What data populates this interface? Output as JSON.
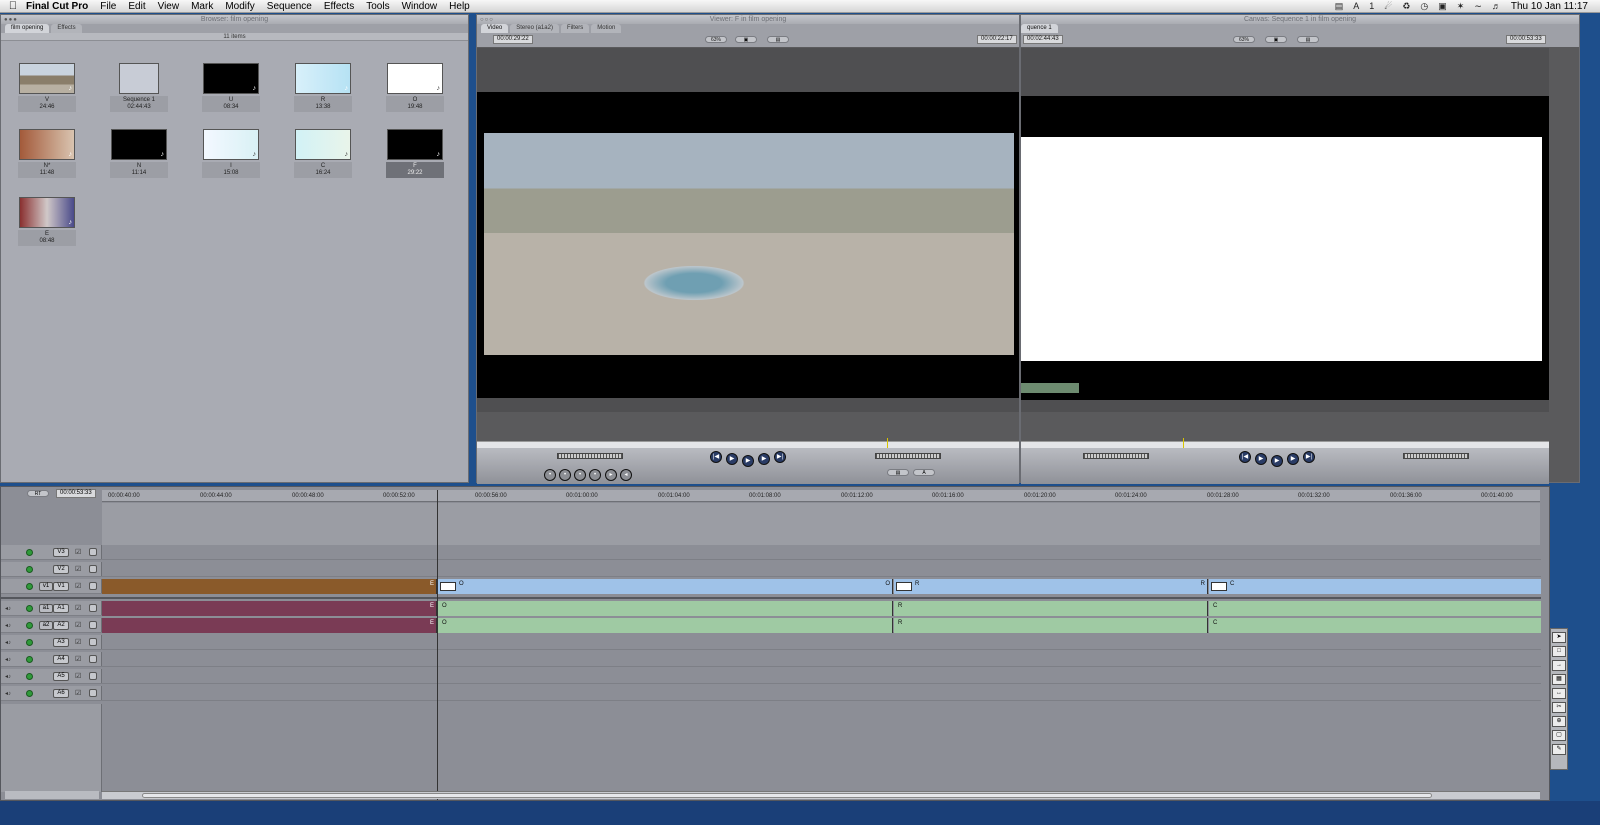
{
  "menubar": {
    "app": "Final Cut Pro",
    "items": [
      "File",
      "Edit",
      "View",
      "Mark",
      "Modify",
      "Sequence",
      "Effects",
      "Tools",
      "Window",
      "Help"
    ],
    "clock": "Thu 10 Jan  11:17",
    "status": "1"
  },
  "browser": {
    "title": "Browser: film opening",
    "tabs": [
      "film opening",
      "Effects"
    ],
    "count": "11 items",
    "clips": [
      {
        "name": "V",
        "dur": "24:46"
      },
      {
        "name": "Sequence 1",
        "dur": "02:44:43"
      },
      {
        "name": "U",
        "dur": "08:34"
      },
      {
        "name": "R",
        "dur": "13:38"
      },
      {
        "name": "O",
        "dur": "19:48"
      },
      {
        "name": "N*",
        "dur": "11:48"
      },
      {
        "name": "N",
        "dur": "11:14"
      },
      {
        "name": "I",
        "dur": "15:08"
      },
      {
        "name": "C",
        "dur": "16:24"
      },
      {
        "name": "F",
        "dur": "29:22"
      },
      {
        "name": "E",
        "dur": "08:48"
      }
    ]
  },
  "viewer": {
    "title": "Viewer: F in film opening",
    "tabs": [
      "Video",
      "Stereo (a1a2)",
      "Filters",
      "Motion"
    ],
    "tc_left": "00:00:29:22",
    "tc_right": "00:00:22:17",
    "zoom": "63%"
  },
  "canvas": {
    "title": "Canvas: Sequence 1 in film opening",
    "tab": "quence 1",
    "tc_left": "00:02:44:43",
    "tc_right": "00:00:53:33",
    "zoom": "63%"
  },
  "timeline": {
    "rt": "RT",
    "tc": "00:00:53:33",
    "ruler": [
      "00:00:40:00",
      "00:00:44:00",
      "00:00:48:00",
      "00:00:52:00",
      "00:00:56:00",
      "00:01:00:00",
      "00:01:04:00",
      "00:01:08:00",
      "00:01:12:00",
      "00:01:16:00",
      "00:01:20:00",
      "00:01:24:00",
      "00:01:28:00",
      "00:01:32:00",
      "00:01:36:00",
      "00:01:40:00"
    ],
    "video_tracks": [
      {
        "name": "V3",
        "src": ""
      },
      {
        "name": "V2",
        "src": ""
      },
      {
        "name": "V1",
        "src": "v1"
      }
    ],
    "audio_tracks": [
      {
        "name": "A1",
        "src": "a1"
      },
      {
        "name": "A2",
        "src": "a2"
      },
      {
        "name": "A3",
        "src": ""
      },
      {
        "name": "A4",
        "src": ""
      },
      {
        "name": "A5",
        "src": ""
      },
      {
        "name": "A6",
        "src": ""
      }
    ],
    "v1_clips": [
      "E",
      "O",
      "R",
      "C"
    ],
    "a_clips": [
      "E",
      "O",
      "R",
      "C"
    ]
  },
  "colors": {
    "video_clip_prev": "#8a5a2a",
    "video_clip": "#9fc2e8",
    "audio_clip_prev": "#7a3b55",
    "audio_clip": "#9fcaa3"
  }
}
